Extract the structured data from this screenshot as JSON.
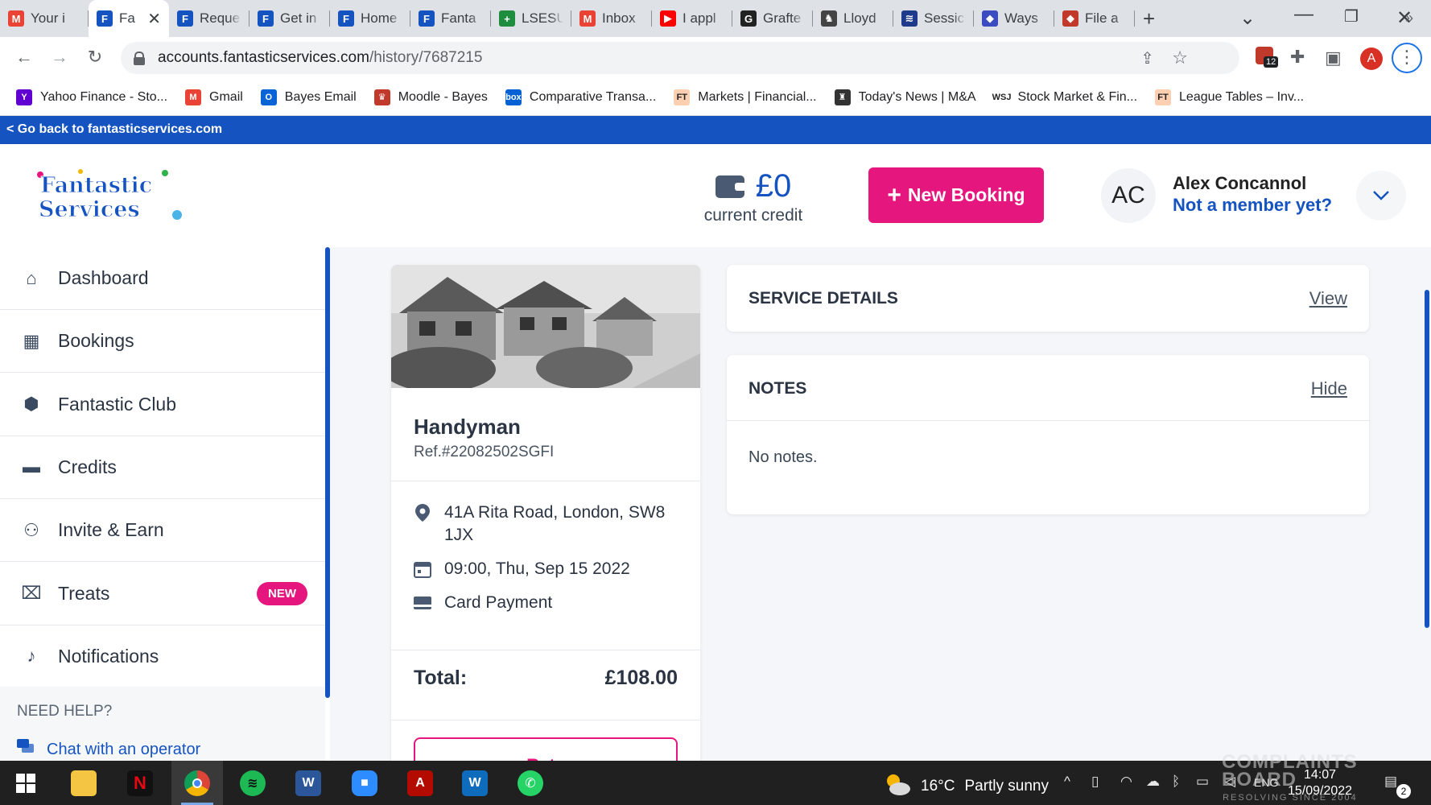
{
  "tabs": [
    {
      "label": "Your i",
      "favicon": "gmail-icon",
      "color": "#ea4335",
      "glyph": "M"
    },
    {
      "label": "Fa",
      "favicon": "fantastic-services-icon",
      "color": "#1554c0",
      "glyph": "F"
    },
    {
      "label": "Reque",
      "favicon": "fantastic-services-icon",
      "color": "#1554c0",
      "glyph": "F"
    },
    {
      "label": "Get in",
      "favicon": "fantastic-services-icon",
      "color": "#1554c0",
      "glyph": "F"
    },
    {
      "label": "Home",
      "favicon": "fantastic-services-icon",
      "color": "#1554c0",
      "glyph": "F"
    },
    {
      "label": "Fanta",
      "favicon": "fantastic-services-icon",
      "color": "#1554c0",
      "glyph": "F"
    },
    {
      "label": "LSESU",
      "favicon": "cross-icon",
      "color": "#1e8e3e",
      "glyph": "+"
    },
    {
      "label": "Inbox",
      "favicon": "gmail-icon",
      "color": "#ea4335",
      "glyph": "M"
    },
    {
      "label": "I appl",
      "favicon": "youtube-icon",
      "color": "#ff0000",
      "glyph": "▶"
    },
    {
      "label": "Grafte",
      "favicon": "grammarly-icon",
      "color": "#222222",
      "glyph": "G"
    },
    {
      "label": "Lloyd",
      "favicon": "horse-icon",
      "color": "#444444",
      "glyph": "♞"
    },
    {
      "label": "Sessic",
      "favicon": "layers-icon",
      "color": "#1e3a8a",
      "glyph": "≋"
    },
    {
      "label": "Ways",
      "favicon": "shield-icon",
      "color": "#3b4cc0",
      "glyph": "◆"
    },
    {
      "label": "File a",
      "favicon": "shield-icon",
      "color": "#c0392b",
      "glyph": "◆"
    }
  ],
  "address": {
    "domain": "accounts.fantasticservices.com",
    "path": "/history/7687215"
  },
  "extension_badge": "12",
  "profile_initial": "A",
  "bookmarks": [
    {
      "label": "Yahoo Finance - Sto...",
      "icon": "yahoo-icon",
      "color": "#6001d2",
      "glyph": "Y"
    },
    {
      "label": "Gmail",
      "icon": "gmail-icon",
      "color": "#ea4335",
      "glyph": "M"
    },
    {
      "label": "Bayes Email",
      "icon": "outlook-icon",
      "color": "#0a64d6",
      "glyph": "O"
    },
    {
      "label": "Moodle - Bayes",
      "icon": "moodle-icon",
      "color": "#c0392b",
      "glyph": "♛"
    },
    {
      "label": "Comparative Transa...",
      "icon": "box-icon",
      "color": "#0061d5",
      "glyph": "box"
    },
    {
      "label": "Markets | Financial...",
      "icon": "ft-icon",
      "color": "#fcd0b1",
      "glyph": "FT"
    },
    {
      "label": "Today's News | M&A",
      "icon": "news-icon",
      "color": "#333333",
      "glyph": "♜"
    },
    {
      "label": "Stock Market & Fin...",
      "icon": "wsj-icon",
      "color": "#ffffff",
      "glyph": "WSJ"
    },
    {
      "label": "League Tables – Inv...",
      "icon": "ft-icon",
      "color": "#fcd0b1",
      "glyph": "FT"
    }
  ],
  "page": {
    "back_link": "< Go back to fantasticservices.com",
    "logo_alt": "Fantastic Services",
    "credit_amount": "£0",
    "credit_label": "current credit",
    "new_booking": "New Booking",
    "avatar_initials": "AC",
    "user_name": "Alex Concannol",
    "member_link": "Not a member yet?"
  },
  "sidebar": {
    "items": [
      {
        "label": "Dashboard",
        "icon": "home-icon"
      },
      {
        "label": "Bookings",
        "icon": "calendar-icon"
      },
      {
        "label": "Fantastic Club",
        "icon": "club-icon"
      },
      {
        "label": "Credits",
        "icon": "wallet-icon"
      },
      {
        "label": "Invite & Earn",
        "icon": "users-icon"
      },
      {
        "label": "Treats",
        "icon": "gift-icon",
        "badge": "NEW"
      },
      {
        "label": "Notifications",
        "icon": "bell-icon"
      }
    ],
    "help_title": "NEED HELP?",
    "chat_label": "Chat with an operator"
  },
  "booking": {
    "service": "Handyman",
    "ref": "Ref.#22082502SGFI",
    "address": "41A Rita Road, London, SW8 1JX",
    "datetime": "09:00, Thu, Sep 15 2022",
    "payment": "Card Payment",
    "total_label": "Total:",
    "total_value": "£108.00",
    "rate_label": "Rate"
  },
  "service_details": {
    "title": "SERVICE DETAILS",
    "link": "View"
  },
  "notes": {
    "title": "NOTES",
    "link": "Hide",
    "body": "No notes."
  },
  "taskbar": {
    "weather_temp": "16°C",
    "weather_text": "Partly sunny",
    "lang": "ENG",
    "time": "14:07",
    "date": "15/09/2022",
    "notifications": "2"
  },
  "watermark": {
    "line1": "COMPLAINTS",
    "line2": "BOARD",
    "tag": "RESOLVING SINCE 2004"
  }
}
